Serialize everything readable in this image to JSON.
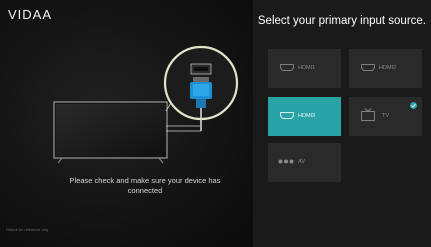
{
  "brand": {
    "logo_text": "VIDAA"
  },
  "prompt": {
    "title": "Select your primary input source.",
    "message": "Please check and make sure your device has connected"
  },
  "footnote": "Picture for reference only",
  "sources": [
    {
      "label": "HDMI1",
      "icon": "hdmi-port-icon",
      "active": false,
      "checked": false
    },
    {
      "label": "HDMI2",
      "icon": "hdmi-port-icon",
      "active": false,
      "checked": false
    },
    {
      "label": "HDMI3",
      "icon": "hdmi-port-icon",
      "active": true,
      "checked": false
    },
    {
      "label": "TV",
      "icon": "tv-antenna-icon",
      "active": false,
      "checked": true
    },
    {
      "label": "AV",
      "icon": "av-connector-icon",
      "active": false,
      "checked": false
    }
  ],
  "colors": {
    "accent": "#2aa3a7",
    "tile": "#2a2a2a",
    "panel": "#1a1a1a",
    "background": "#0c0c0c"
  }
}
